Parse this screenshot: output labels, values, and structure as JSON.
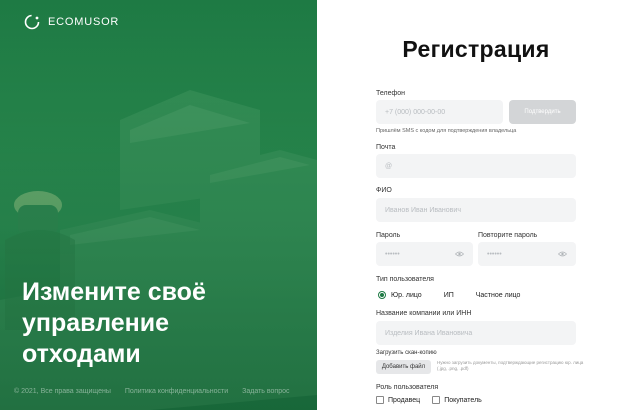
{
  "brand": {
    "name": "ECOMUSOR",
    "accent": "#1e7a44"
  },
  "hero": {
    "headline": [
      "Измените своё",
      "управление",
      "отходами"
    ],
    "footer": [
      "© 2021, Все права защищены",
      "Политика конфиденциальности",
      "Задать вопрос"
    ]
  },
  "form": {
    "title": "Регистрация",
    "phone": {
      "label": "Телефон",
      "placeholder": "+7 (000) 000-00-00",
      "confirm": "Подтвердить",
      "hint": "Пришлём SMS с кодом для подтверждения владельца"
    },
    "email": {
      "label": "Почта",
      "placeholder": "@"
    },
    "fio": {
      "label": "ФИО",
      "placeholder": "Иванов Иван Иванович"
    },
    "password": {
      "label": "Пароль",
      "placeholder": "••••••"
    },
    "password_repeat": {
      "label": "Повторите пароль",
      "placeholder": "••••••"
    },
    "user_type": {
      "label": "Тип пользователя",
      "options": [
        "Юр. лицо",
        "ИП",
        "Частное лицо"
      ],
      "selected": "Юр. лицо"
    },
    "company": {
      "label": "Название компании или ИНН",
      "placeholder": "Изделия Ивана Ивановича"
    },
    "upload": {
      "label": "Загрузить скан-копию",
      "button": "Добавить файл",
      "hint": "Нужно загрузить документы, подтверждающие регистрацию юр. лица (.jpg, .png, .pdf)"
    },
    "role": {
      "label": "Роль пользователя",
      "options": [
        "Продавец",
        "Покупатель"
      ]
    }
  }
}
